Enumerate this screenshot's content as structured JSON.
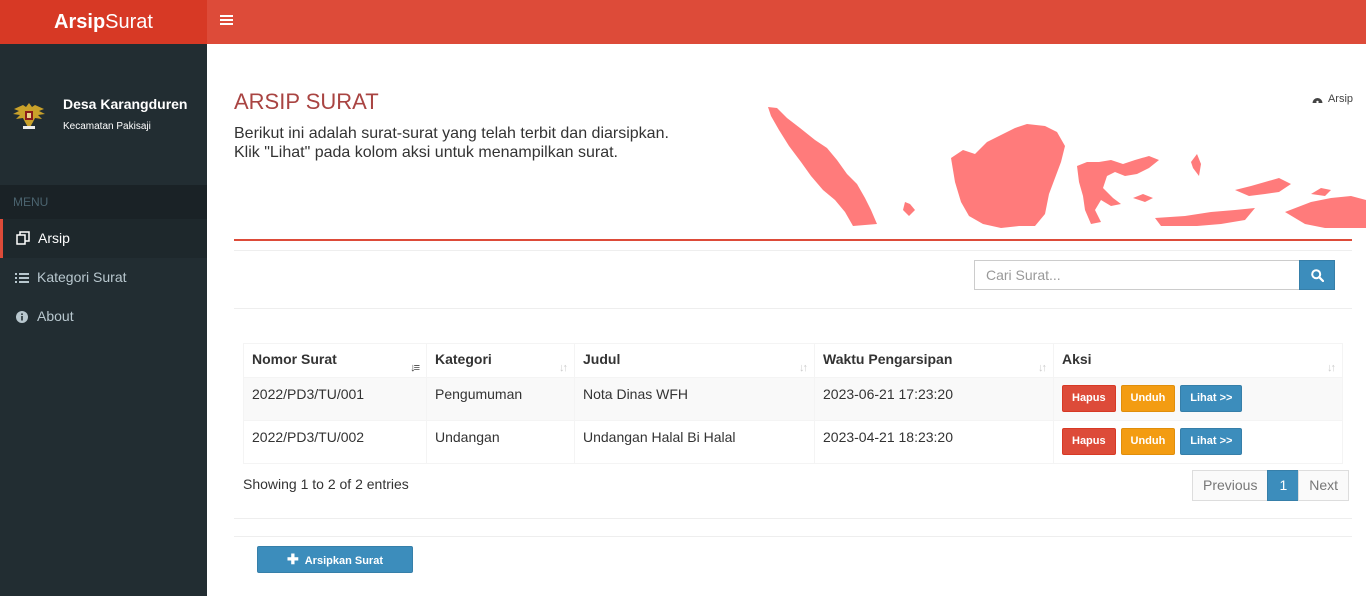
{
  "brand": {
    "bold": "Arsip",
    "light": "Surat"
  },
  "user": {
    "name": "Desa Karangduren",
    "subtitle": "Kecamatan Pakisaji"
  },
  "sidebar": {
    "header": "MENU",
    "items": [
      {
        "label": "Arsip",
        "icon": "copy-icon",
        "active": true
      },
      {
        "label": "Kategori Surat",
        "icon": "list-icon",
        "active": false
      },
      {
        "label": "About",
        "icon": "info-circle-icon",
        "active": false
      }
    ]
  },
  "page": {
    "title": "ARSIP SURAT",
    "desc_line1": "Berikut ini adalah surat-surat yang telah terbit dan diarsipkan.",
    "desc_line2": "Klik \"Lihat\" pada kolom aksi untuk menampilkan surat.",
    "breadcrumb": "Arsip"
  },
  "search": {
    "placeholder": "Cari Surat..."
  },
  "table": {
    "headers": [
      "Nomor Surat",
      "Kategori",
      "Judul",
      "Waktu Pengarsipan",
      "Aksi"
    ],
    "rows": [
      {
        "nomor": "2022/PD3/TU/001",
        "kategori": "Pengumuman",
        "judul": "Nota Dinas WFH",
        "waktu": "2023-06-21 17:23:20"
      },
      {
        "nomor": "2022/PD3/TU/002",
        "kategori": "Undangan",
        "judul": "Undangan Halal Bi Halal",
        "waktu": "2023-04-21 18:23:20"
      }
    ],
    "actions": {
      "hapus": "Hapus",
      "unduh": "Unduh",
      "lihat": "Lihat >>"
    }
  },
  "footer": {
    "showing": "Showing 1 to 2 of 2 entries",
    "prev": "Previous",
    "page": "1",
    "next": "Next"
  },
  "add_button": "Arsipkan Surat",
  "colors": {
    "header": "#dd4b39",
    "logo": "#d73925",
    "sidebar": "#222d32",
    "primary": "#3c8dbc",
    "warning": "#f39c12",
    "map": "#ff7b7b"
  }
}
